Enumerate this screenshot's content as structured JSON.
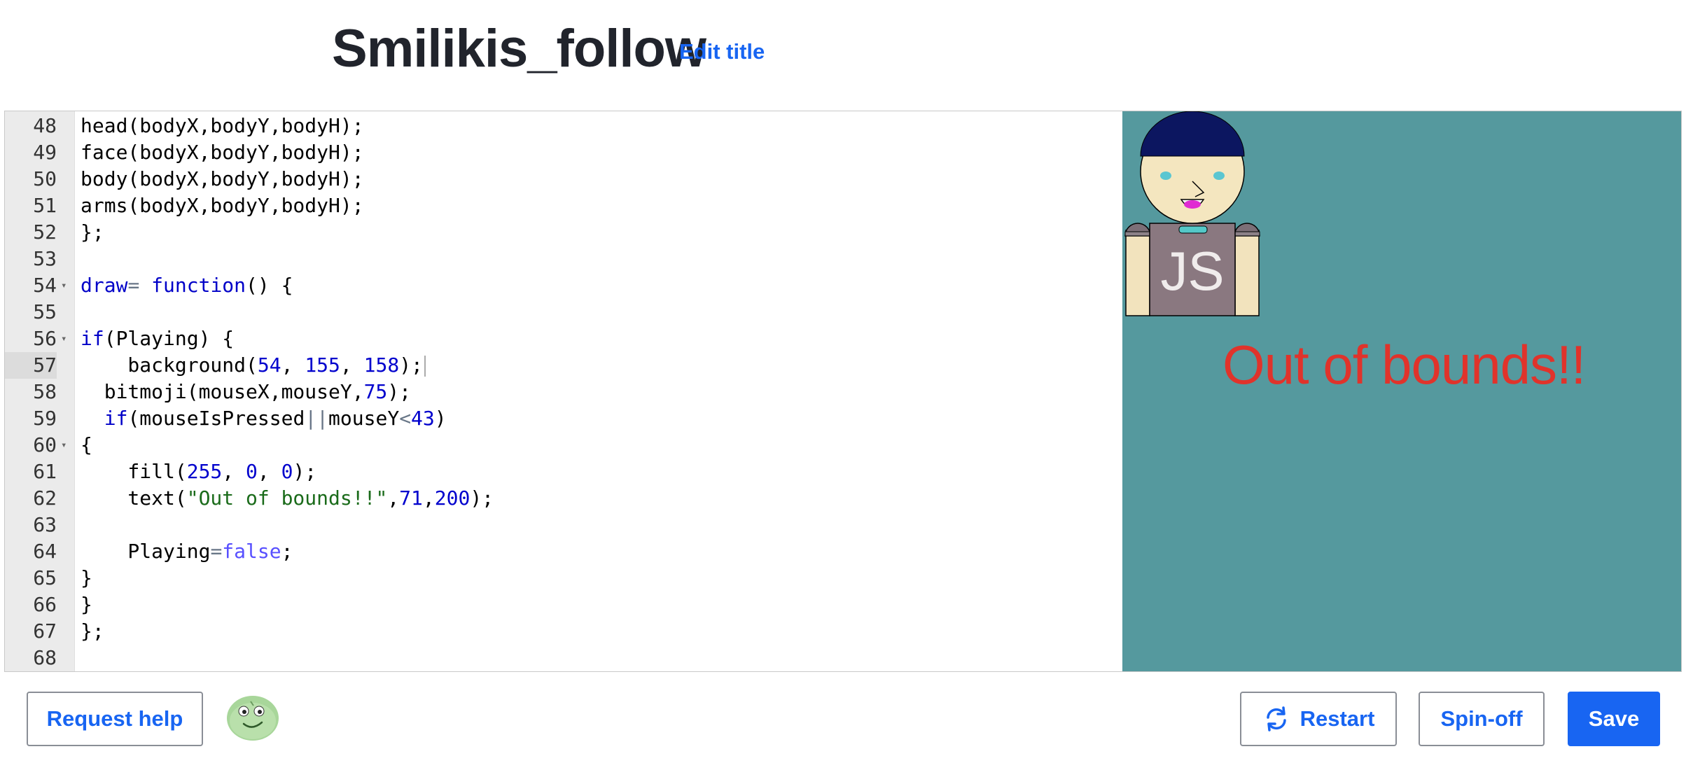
{
  "header": {
    "title": "Smilikis_follow",
    "edit_title": "Edit title"
  },
  "editor": {
    "lines": [
      {
        "n": "48",
        "fold": false,
        "tokens": [
          [
            "",
            "head(bodyX,bodyY,bodyH);"
          ]
        ]
      },
      {
        "n": "49",
        "fold": false,
        "tokens": [
          [
            "",
            "face(bodyX,bodyY,bodyH);"
          ]
        ]
      },
      {
        "n": "50",
        "fold": false,
        "tokens": [
          [
            "",
            "body(bodyX,bodyY,bodyH);"
          ]
        ]
      },
      {
        "n": "51",
        "fold": false,
        "tokens": [
          [
            "",
            "arms(bodyX,bodyY,bodyH);"
          ]
        ]
      },
      {
        "n": "52",
        "fold": false,
        "tokens": [
          [
            "",
            "};"
          ]
        ]
      },
      {
        "n": "53",
        "fold": false,
        "tokens": []
      },
      {
        "n": "54",
        "fold": true,
        "tokens": [
          [
            "kw",
            "draw"
          ],
          [
            "op",
            "="
          ],
          [
            "",
            " "
          ],
          [
            "kw",
            "function"
          ],
          [
            "",
            "() {"
          ]
        ]
      },
      {
        "n": "55",
        "fold": false,
        "tokens": []
      },
      {
        "n": "56",
        "fold": true,
        "tokens": [
          [
            "kw",
            "if"
          ],
          [
            "",
            "(Playing) {"
          ]
        ]
      },
      {
        "n": "57",
        "fold": false,
        "active": true,
        "tokens": [
          [
            "",
            "    background("
          ],
          [
            "num",
            "54"
          ],
          [
            "",
            ", "
          ],
          [
            "num",
            "155"
          ],
          [
            "",
            ", "
          ],
          [
            "num",
            "158"
          ],
          [
            "",
            ");"
          ]
        ]
      },
      {
        "n": "58",
        "fold": false,
        "tokens": [
          [
            "",
            "  bitmoji(mouseX,mouseY,"
          ],
          [
            "num",
            "75"
          ],
          [
            "",
            ");"
          ]
        ]
      },
      {
        "n": "59",
        "fold": false,
        "tokens": [
          [
            "",
            "  "
          ],
          [
            "kw",
            "if"
          ],
          [
            "",
            "(mouseIsPressed"
          ],
          [
            "op",
            "||"
          ],
          [
            "",
            "mouseY"
          ],
          [
            "op",
            "<"
          ],
          [
            "num",
            "43"
          ],
          [
            "",
            ")"
          ]
        ]
      },
      {
        "n": "60",
        "fold": true,
        "tokens": [
          [
            "",
            "{"
          ]
        ]
      },
      {
        "n": "61",
        "fold": false,
        "tokens": [
          [
            "",
            "    fill("
          ],
          [
            "num",
            "255"
          ],
          [
            "",
            ", "
          ],
          [
            "num",
            "0"
          ],
          [
            "",
            ", "
          ],
          [
            "num",
            "0"
          ],
          [
            "",
            ");"
          ]
        ]
      },
      {
        "n": "62",
        "fold": false,
        "tokens": [
          [
            "",
            "    text("
          ],
          [
            "str",
            "\"Out of bounds!!\""
          ],
          [
            "",
            ","
          ],
          [
            "num",
            "71"
          ],
          [
            "",
            ","
          ],
          [
            "num",
            "200"
          ],
          [
            "",
            ");"
          ]
        ]
      },
      {
        "n": "63",
        "fold": false,
        "tokens": []
      },
      {
        "n": "64",
        "fold": false,
        "tokens": [
          [
            "",
            "    Playing"
          ],
          [
            "op",
            "="
          ],
          [
            "bool",
            "false"
          ],
          [
            "",
            ";"
          ]
        ]
      },
      {
        "n": "65",
        "fold": false,
        "tokens": [
          [
            "",
            "}"
          ]
        ]
      },
      {
        "n": "66",
        "fold": false,
        "tokens": [
          [
            "",
            "}"
          ]
        ]
      },
      {
        "n": "67",
        "fold": false,
        "tokens": [
          [
            "",
            "};"
          ]
        ]
      },
      {
        "n": "68",
        "fold": false,
        "tokens": []
      }
    ]
  },
  "canvas": {
    "background": "#55999e",
    "message": "Out of bounds!!",
    "message_color": "#e0332b",
    "shirt_text": "JS"
  },
  "footer": {
    "request_help": "Request help",
    "restart": "Restart",
    "spinoff": "Spin-off",
    "save": "Save"
  },
  "colors": {
    "accent": "#1865f2"
  }
}
